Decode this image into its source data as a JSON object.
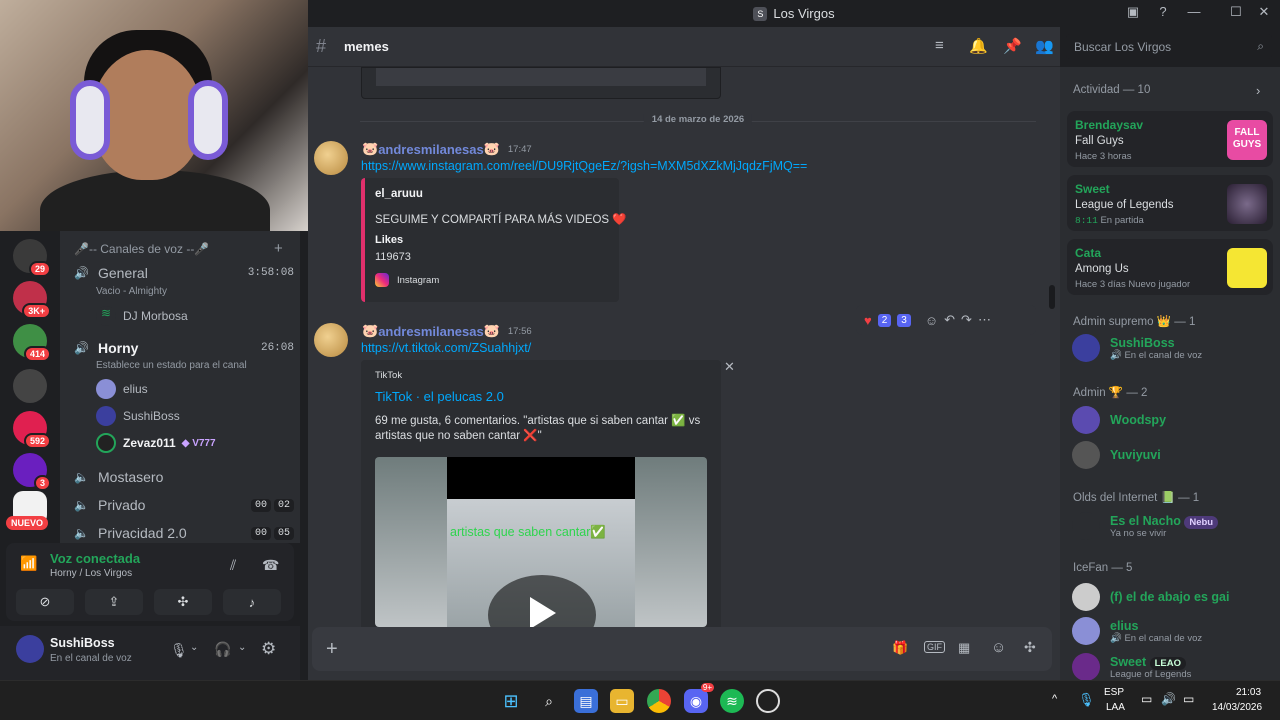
{
  "window": {
    "title": "Los Virgos"
  },
  "rail": {
    "badges": [
      "29",
      "3K+",
      "414",
      "592",
      "3"
    ],
    "new_label": "NUEVO"
  },
  "channels": {
    "category": "🎤-- Canales de voz --🎤",
    "general": {
      "name": "General",
      "time": "3:58:08",
      "status": "Vacio - Almighty",
      "member": "DJ Morbosa"
    },
    "horny": {
      "name": "Horny",
      "time": "26:08",
      "status": "Establece un estado para el canal",
      "members": [
        "elius",
        "SushiBoss",
        "Zevaz011"
      ],
      "member_tag": "V777"
    },
    "others": [
      {
        "name": "Mostasero",
        "count_a": "",
        "count_b": ""
      },
      {
        "name": "Privado",
        "count_a": "00",
        "count_b": "02"
      },
      {
        "name": "Privacidad 2.0",
        "count_a": "00",
        "count_b": "05"
      }
    ]
  },
  "voice_panel": {
    "title": "Voz conectada",
    "subtitle": "Horny / Los Virgos"
  },
  "user_panel": {
    "username": "SushiBoss",
    "status": "En el canal de voz"
  },
  "header": {
    "channel": "memes",
    "search_placeholder": "Buscar Los Virgos"
  },
  "messages": {
    "date_separator": "14 de marzo de 2026",
    "msg1": {
      "author": "andresmilanesas",
      "time": "17:47",
      "link": "https://www.instagram.com/reel/DU9RjtQgeEz/?igsh=MXM5dXZkMjJqdzFjMQ==",
      "embed_author": "el_aruuu",
      "embed_text": "SEGUIME Y COMPARTÍ PARA MÁS VIDEOS ❤️",
      "field_name": "Likes",
      "field_value": "119673",
      "footer": "Instagram"
    },
    "msg2": {
      "author": "andresmilanesas",
      "time": "17:56",
      "link": "https://vt.tiktok.com/ZSuahhjxt/",
      "provider": "TikTok",
      "embed_title": "TikTok · el pelucas 2.0",
      "embed_desc": "69 me gusta, 6 comentarios. \"artistas que si saben cantar ✅ vs artistas que no saben cantar ❌\"",
      "video_caption": "artistas que saben cantar✅"
    },
    "reactions": [
      "2",
      "3"
    ]
  },
  "activity": {
    "header": "Actividad — 10",
    "items": [
      {
        "who": "Brendaysav",
        "game": "Fall Guys",
        "meta": "Hace 3 horas",
        "art": "FALL GUYS"
      },
      {
        "who": "Sweet",
        "game": "League of Legends",
        "meta": "8:11",
        "meta2": "En partida"
      },
      {
        "who": "Cata",
        "game": "Among Us",
        "meta": "Hace 3 días",
        "meta2": "Nuevo jugador"
      }
    ]
  },
  "members": {
    "admin_supremo": {
      "label": "Admin supremo",
      "count": "— 1"
    },
    "sushiboss": {
      "name": "SushiBoss",
      "status": "En el canal de voz"
    },
    "admin": {
      "label": "Admin",
      "count": "— 2"
    },
    "woodspy": "Woodspy",
    "yuviyuvi": "Yuviyuvi",
    "olds": {
      "label": "Olds del Internet",
      "count": "— 1"
    },
    "nacho": {
      "name": "Es el Nacho",
      "tag": "Nebu",
      "status": "Ya no se vivir"
    },
    "icefan": "IceFan — 5",
    "f_member": "(f) el de abajo es gai",
    "elius": {
      "name": "elius",
      "status": "En el canal de voz"
    },
    "sweet": {
      "name": "Sweet",
      "tag": "LEAO",
      "status": "League of Legends"
    }
  },
  "taskbar": {
    "lang1": "ESP",
    "lang2": "LAA",
    "time": "21:03",
    "date": "14/03/2026",
    "discord_badge": "9+"
  }
}
